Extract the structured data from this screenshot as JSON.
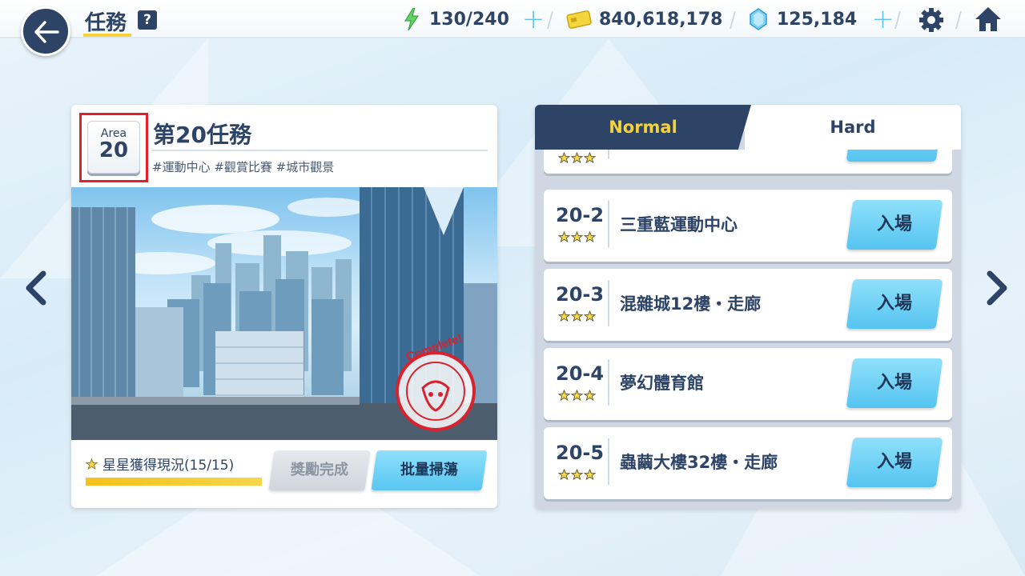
{
  "header": {
    "title": "任務",
    "help_icon": "?",
    "stamina": "130/240",
    "credits": "840,618,178",
    "gems": "125,184"
  },
  "icons": {
    "back": "back-arrow-icon",
    "help": "question-icon",
    "stamina": "lightning-icon",
    "credits": "credit-card-icon",
    "gems": "crystal-icon",
    "settings": "gear-icon",
    "home": "home-icon"
  },
  "area": {
    "label": "Area",
    "number": "20",
    "title": "第20任務",
    "tags": "#運動中心 #觀賞比賽 #城市觀景",
    "stamp_text": "Complete!",
    "star_status": "星星獲得現況(15/15)",
    "star_progress": 1.0,
    "reward_button": "獎勵完成",
    "sweep_button": "批量掃蕩"
  },
  "tabs": {
    "normal": "Normal",
    "hard": "Hard",
    "active": "Normal"
  },
  "stages": [
    {
      "id": "20-2",
      "name": "三重藍運動中心",
      "stars": 3,
      "enter": "入場"
    },
    {
      "id": "20-3",
      "name": "混雜城12樓・走廊",
      "stars": 3,
      "enter": "入場"
    },
    {
      "id": "20-4",
      "name": "夢幻體育館",
      "stars": 3,
      "enter": "入場"
    },
    {
      "id": "20-5",
      "name": "蟲繭大樓32樓・走廊",
      "stars": 3,
      "enter": "入場"
    }
  ],
  "colors": {
    "navy": "#2d4467",
    "accent_yellow": "#f5d13a",
    "button_blue": "#58c6f1",
    "highlight_red": "#e0202a"
  }
}
